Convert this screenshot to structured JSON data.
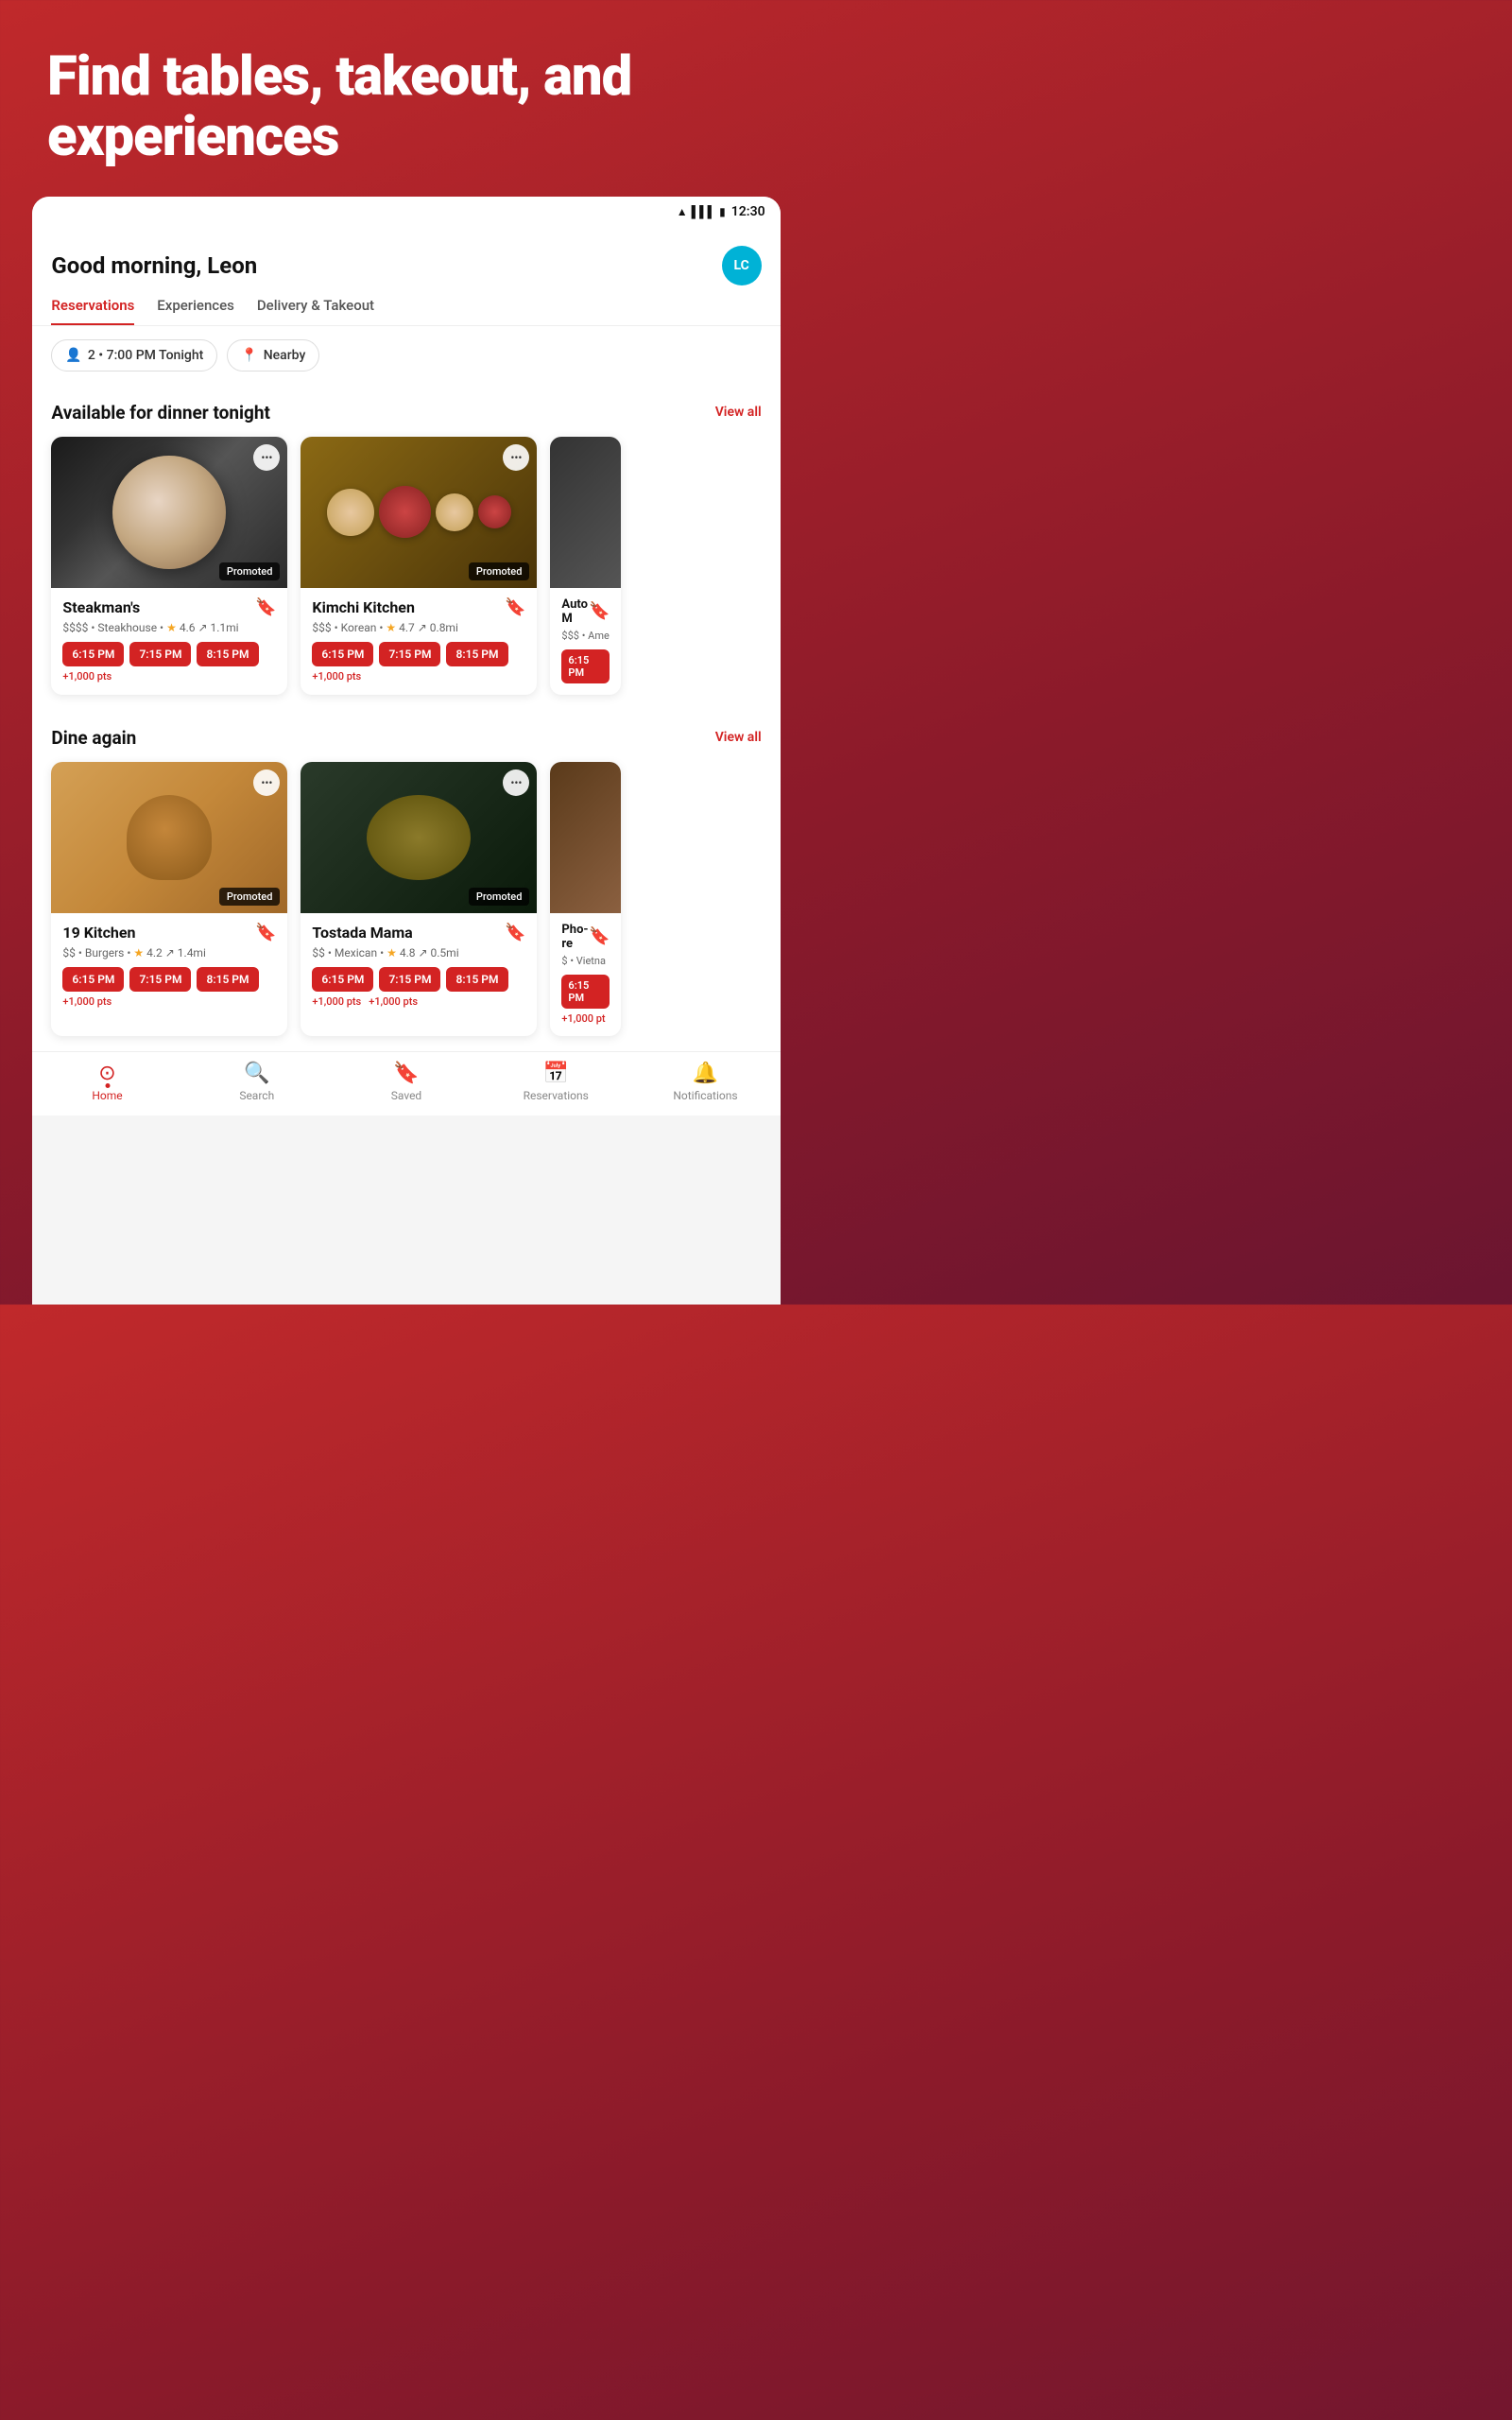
{
  "hero": {
    "title": "Find tables, takeout, and experiences"
  },
  "statusBar": {
    "time": "12:30",
    "icons": "wifi signal battery"
  },
  "header": {
    "greeting": "Good morning, Leon",
    "avatarInitials": "LC",
    "avatarColor": "#00b2d6"
  },
  "tabs": [
    {
      "label": "Reservations",
      "active": true
    },
    {
      "label": "Experiences",
      "active": false
    },
    {
      "label": "Delivery & Takeout",
      "active": false
    }
  ],
  "filters": [
    {
      "icon": "👤",
      "label": "2 • 7:00 PM Tonight"
    },
    {
      "icon": "📍",
      "label": "Nearby"
    }
  ],
  "sections": [
    {
      "title": "Available for dinner tonight",
      "viewAll": "View all",
      "restaurants": [
        {
          "name": "Steakman's",
          "price": "$$$$",
          "cuisine": "Steakhouse",
          "rating": "4.6",
          "distance": "1.1mi",
          "promoted": true,
          "timeSlots": [
            "6:15 PM",
            "7:15 PM",
            "8:15 PM"
          ],
          "pts": "+1,000 pts",
          "type": "steakman"
        },
        {
          "name": "Kimchi Kitchen",
          "price": "$$$",
          "cuisine": "Korean",
          "rating": "4.7",
          "distance": "0.8mi",
          "promoted": true,
          "timeSlots": [
            "6:15 PM",
            "7:15 PM",
            "8:15 PM"
          ],
          "pts": "+1,000 pts",
          "type": "kimchi"
        },
        {
          "name": "Auto M",
          "price": "$$$",
          "cuisine": "Ame",
          "rating": "",
          "distance": "",
          "promoted": false,
          "timeSlots": [
            "6:15 PM"
          ],
          "pts": "",
          "type": "partial"
        }
      ]
    },
    {
      "title": "Dine again",
      "viewAll": "View all",
      "restaurants": [
        {
          "name": "19 Kitchen",
          "price": "$$",
          "cuisine": "Burgers",
          "rating": "4.2",
          "distance": "1.4mi",
          "promoted": true,
          "timeSlots": [
            "6:15 PM",
            "7:15 PM",
            "8:15 PM"
          ],
          "pts": "+1,000 pts",
          "type": "kitchen19"
        },
        {
          "name": "Tostada Mama",
          "price": "$$",
          "cuisine": "Mexican",
          "rating": "4.8",
          "distance": "0.5mi",
          "promoted": true,
          "timeSlots": [
            "6:15 PM",
            "7:15 PM",
            "8:15 PM"
          ],
          "pts": "+1,000 pts",
          "ptsSlot2": "+1,000 pts",
          "type": "tostada"
        },
        {
          "name": "Pho-re",
          "price": "$",
          "cuisine": "Vietna",
          "rating": "",
          "distance": "",
          "promoted": false,
          "timeSlots": [
            "6:15 PM"
          ],
          "pts": "+1,000 pt",
          "type": "partial2"
        }
      ]
    }
  ],
  "bottomNav": [
    {
      "icon": "🏠",
      "label": "Home",
      "active": true
    },
    {
      "icon": "🔍",
      "label": "Search",
      "active": false
    },
    {
      "icon": "🔖",
      "label": "Saved",
      "active": false
    },
    {
      "icon": "📅",
      "label": "Reservations",
      "active": false
    },
    {
      "icon": "🔔",
      "label": "Notifications",
      "active": false
    }
  ],
  "promoted_label": "Promoted"
}
